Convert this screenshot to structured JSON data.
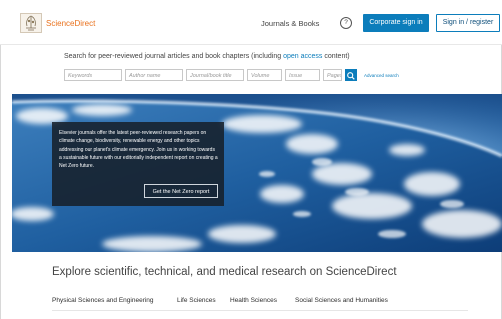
{
  "header": {
    "brand": "ScienceDirect",
    "nav_journals": "Journals & Books",
    "help_symbol": "?",
    "corporate_signin": "Corporate sign in",
    "signin_register": "Sign in / register"
  },
  "search": {
    "prompt_before": "Search for peer-reviewed journal articles and book chapters (including ",
    "prompt_link": "open access",
    "prompt_after": " content)",
    "fields": {
      "keywords": "Keywords",
      "author": "Author name",
      "journal": "Journal/book title",
      "volume": "Volume",
      "issue": "Issue",
      "pages": "Pages"
    },
    "advanced": "Advanced search"
  },
  "hero": {
    "promo_text": "Elsevier journals offer the latest peer-reviewed research papers on climate change, biodiversity, renewable energy and other topics addressing our planet's climate emergency. Join us in working towards a sustainable future with our editorially independent report on creating a Net Zero future.",
    "promo_button": "Get the Net Zero report"
  },
  "explore": {
    "title": "Explore scientific, technical, and medical research on ScienceDirect",
    "subjects": [
      "Physical Sciences and Engineering",
      "Life Sciences",
      "Health Sciences",
      "Social Sciences and Humanities"
    ]
  },
  "colors": {
    "brand_orange": "#e9711c",
    "primary_blue": "#0c7dbb"
  }
}
